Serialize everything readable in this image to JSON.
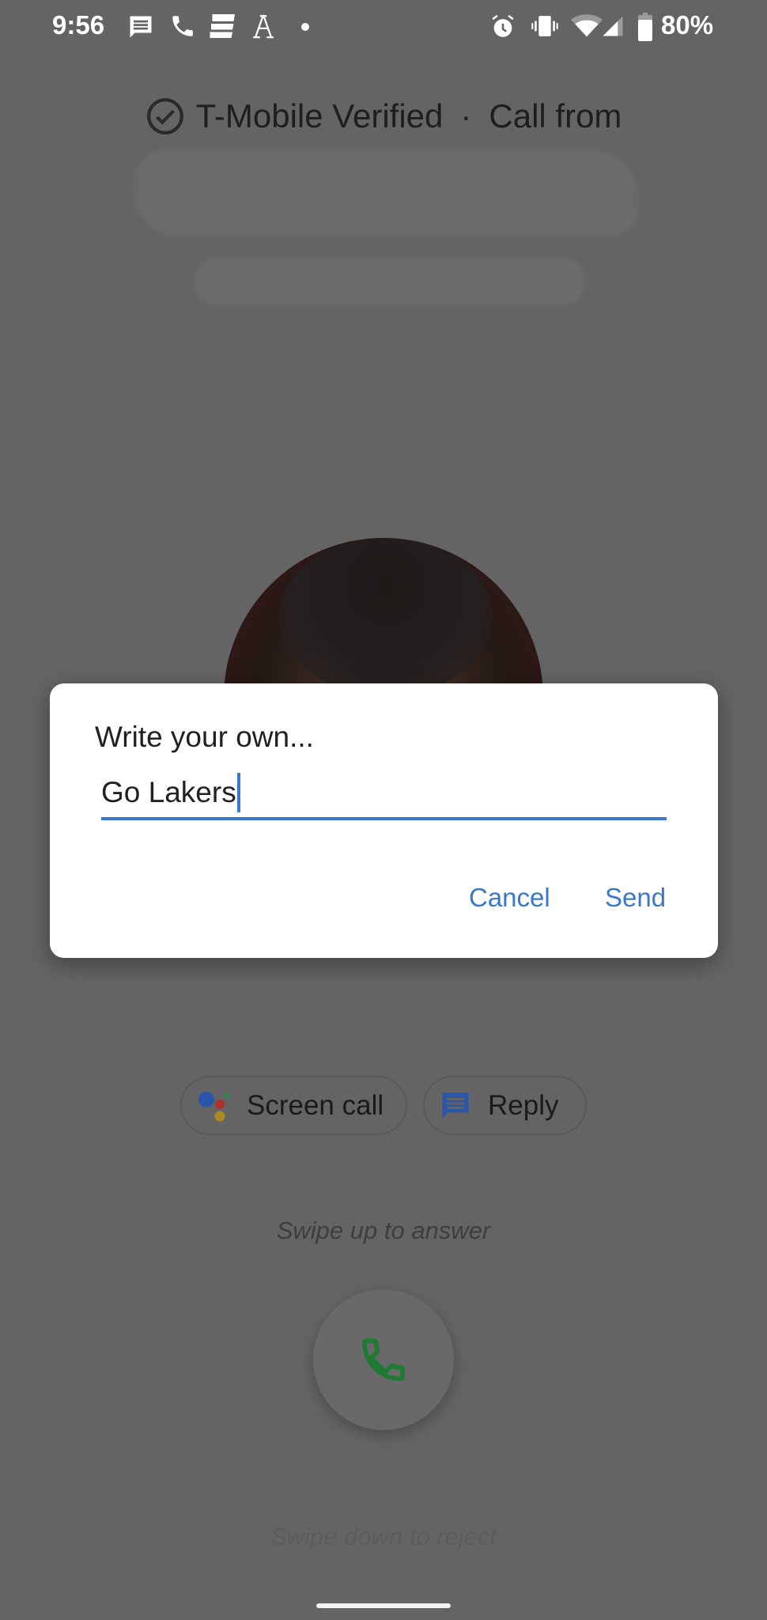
{
  "status_bar": {
    "time": "9:56",
    "notification_icons": [
      "messages-icon",
      "phone-icon",
      "news-icon",
      "font-app-icon",
      "more-dot-icon"
    ],
    "system_icons": [
      "alarm-icon",
      "vibrate-icon",
      "wifi-icon",
      "cell-signal-icon",
      "battery-icon"
    ],
    "battery_percent": "80%"
  },
  "call_header": {
    "verified_label": "T-Mobile Verified",
    "separator": "·",
    "call_label": "Call from"
  },
  "dialog": {
    "title": "Write your own...",
    "input_value": "Go Lakers",
    "cancel_label": "Cancel",
    "send_label": "Send",
    "accent_color": "#3b78c9"
  },
  "actions": {
    "screen_call_label": "Screen call",
    "reply_label": "Reply"
  },
  "hints": {
    "swipe_up": "Swipe up to answer",
    "swipe_down": "Swipe down to reject"
  },
  "colors": {
    "scrim": "#646464",
    "answer_green": "#1e7a34",
    "assistant_blue": "#2a55a8",
    "assistant_red": "#b03030",
    "assistant_yellow": "#b08a20",
    "assistant_green": "#2a8a4a"
  }
}
